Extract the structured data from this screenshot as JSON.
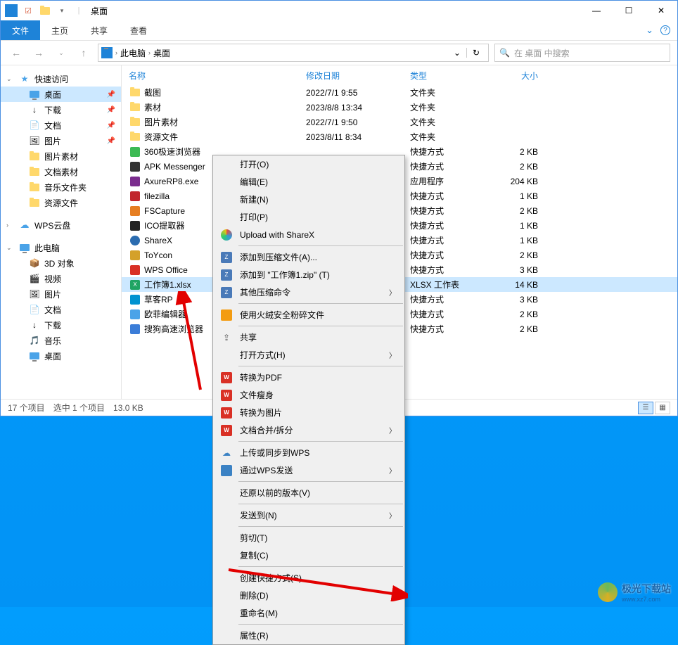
{
  "window": {
    "title": "桌面",
    "controls": {
      "min": "—",
      "max": "☐",
      "close": "✕"
    }
  },
  "ribbon": {
    "file": "文件",
    "tabs": [
      "主页",
      "共享",
      "查看"
    ]
  },
  "address": {
    "segments": [
      "此电脑",
      "桌面"
    ],
    "refresh": "↻",
    "dropdown": "⌄"
  },
  "search": {
    "placeholder": "在 桌面 中搜索",
    "icon": "🔍"
  },
  "sidebar": {
    "quick": {
      "label": "快速访问",
      "icon": "★"
    },
    "pinned": [
      {
        "label": "桌面",
        "icon": "monitor",
        "selected": true,
        "pin": true
      },
      {
        "label": "下载",
        "icon": "↓",
        "pin": true
      },
      {
        "label": "文档",
        "icon": "📄",
        "pin": true
      },
      {
        "label": "图片",
        "icon": "🖼",
        "pin": true
      },
      {
        "label": "图片素材",
        "icon": "folder"
      },
      {
        "label": "文档素材",
        "icon": "folder"
      },
      {
        "label": "音乐文件夹",
        "icon": "folder"
      },
      {
        "label": "资源文件",
        "icon": "folder"
      }
    ],
    "wps": {
      "label": "WPS云盘",
      "icon": "cloud"
    },
    "thispc": {
      "label": "此电脑",
      "icon": "monitor"
    },
    "pcitems": [
      {
        "label": "3D 对象",
        "icon": "📦"
      },
      {
        "label": "视频",
        "icon": "🎬"
      },
      {
        "label": "图片",
        "icon": "🖼"
      },
      {
        "label": "文档",
        "icon": "📄"
      },
      {
        "label": "下载",
        "icon": "↓"
      },
      {
        "label": "音乐",
        "icon": "🎵"
      },
      {
        "label": "桌面",
        "icon": "monitor"
      }
    ]
  },
  "columns": {
    "name": "名称",
    "date": "修改日期",
    "type": "类型",
    "size": "大小"
  },
  "files": [
    {
      "icon": "folder",
      "name": "截图",
      "date": "2022/7/1 9:55",
      "type": "文件夹",
      "size": ""
    },
    {
      "icon": "folder",
      "name": "素材",
      "date": "2023/8/8 13:34",
      "type": "文件夹",
      "size": ""
    },
    {
      "icon": "folder",
      "name": "图片素材",
      "date": "2022/7/1 9:50",
      "type": "文件夹",
      "size": ""
    },
    {
      "icon": "folder",
      "name": "资源文件",
      "date": "2023/8/11 8:34",
      "type": "文件夹",
      "size": ""
    },
    {
      "icon": "app-green",
      "name": "360极速浏览器",
      "date": "",
      "type": "快捷方式",
      "size": "2 KB"
    },
    {
      "icon": "app-dark",
      "name": "APK Messenger",
      "date": "",
      "type": "快捷方式",
      "size": "2 KB"
    },
    {
      "icon": "app-purple",
      "name": "AxureRP8.exe",
      "date": "",
      "type": "应用程序",
      "size": "204 KB"
    },
    {
      "icon": "app-red",
      "name": "filezilla",
      "date": "",
      "type": "快捷方式",
      "size": "1 KB"
    },
    {
      "icon": "app-orange",
      "name": "FSCapture",
      "date": "",
      "type": "快捷方式",
      "size": "2 KB"
    },
    {
      "icon": "app-dark2",
      "name": "ICO提取器",
      "date": "",
      "type": "快捷方式",
      "size": "1 KB"
    },
    {
      "icon": "app-sharex",
      "name": "ShareX",
      "date": "",
      "type": "快捷方式",
      "size": "1 KB"
    },
    {
      "icon": "app-toy",
      "name": "ToYcon",
      "date": "",
      "type": "快捷方式",
      "size": "2 KB"
    },
    {
      "icon": "app-wps",
      "name": "WPS Office",
      "date": "",
      "type": "快捷方式",
      "size": "3 KB"
    },
    {
      "icon": "xlsx",
      "name": "工作簿1.xlsx",
      "date": "",
      "type": "XLSX 工作表",
      "size": "14 KB",
      "selected": true
    },
    {
      "icon": "app-axure",
      "name": "草客RP",
      "date": "",
      "type": "快捷方式",
      "size": "3 KB"
    },
    {
      "icon": "app-ofei",
      "name": "欧菲编辑器",
      "date": "",
      "type": "快捷方式",
      "size": "2 KB"
    },
    {
      "icon": "app-sogou",
      "name": "搜狗高速浏览器",
      "date": "",
      "type": "快捷方式",
      "size": "2 KB"
    }
  ],
  "status": {
    "count": "17 个项目",
    "selection": "选中 1 个项目",
    "size": "13.0 KB"
  },
  "context_menu": {
    "groups": [
      [
        {
          "label": "打开(O)",
          "icon": ""
        },
        {
          "label": "编辑(E)",
          "icon": ""
        },
        {
          "label": "新建(N)",
          "icon": ""
        },
        {
          "label": "打印(P)",
          "icon": ""
        },
        {
          "label": "Upload with ShareX",
          "icon": "sharex"
        }
      ],
      [
        {
          "label": "添加到压缩文件(A)...",
          "icon": "zip"
        },
        {
          "label": "添加到 \"工作簿1.zip\" (T)",
          "icon": "zip"
        },
        {
          "label": "其他压缩命令",
          "icon": "zip",
          "arrow": true
        }
      ],
      [
        {
          "label": "使用火绒安全粉碎文件",
          "icon": "huorong"
        }
      ],
      [
        {
          "label": "共享",
          "icon": "share"
        },
        {
          "label": "打开方式(H)",
          "icon": "",
          "arrow": true
        }
      ],
      [
        {
          "label": "转换为PDF",
          "icon": "wps-red"
        },
        {
          "label": "文件瘦身",
          "icon": "wps-red"
        },
        {
          "label": "转换为图片",
          "icon": "wps-red"
        },
        {
          "label": "文档合并/拆分",
          "icon": "wps-red",
          "arrow": true
        }
      ],
      [
        {
          "label": "上传或同步到WPS",
          "icon": "wps-cloud"
        },
        {
          "label": "通过WPS发送",
          "icon": "wps-send",
          "arrow": true
        }
      ],
      [
        {
          "label": "还原以前的版本(V)",
          "icon": ""
        }
      ],
      [
        {
          "label": "发送到(N)",
          "icon": "",
          "arrow": true
        }
      ],
      [
        {
          "label": "剪切(T)",
          "icon": ""
        },
        {
          "label": "复制(C)",
          "icon": ""
        }
      ],
      [
        {
          "label": "创建快捷方式(S)",
          "icon": ""
        },
        {
          "label": "删除(D)",
          "icon": ""
        },
        {
          "label": "重命名(M)",
          "icon": ""
        }
      ],
      [
        {
          "label": "属性(R)",
          "icon": ""
        }
      ]
    ]
  },
  "watermark": {
    "text": "极光下载站",
    "sub": "www.xz7.com"
  }
}
